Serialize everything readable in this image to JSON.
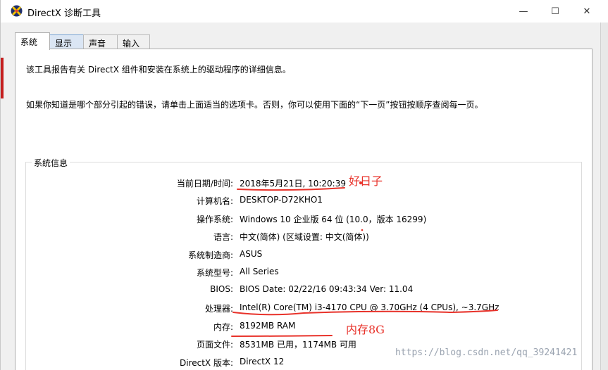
{
  "window": {
    "title": "DirectX 诊断工具",
    "controls": {
      "minimize": "—",
      "maximize": "☐",
      "close": "✕"
    }
  },
  "tabs": [
    {
      "label": "系统",
      "active": true
    },
    {
      "label": "显示",
      "active": false
    },
    {
      "label": "声音",
      "active": false
    },
    {
      "label": "输入",
      "active": false
    }
  ],
  "intro": {
    "line1": "该工具报告有关 DirectX 组件和安装在系统上的驱动程序的详细信息。",
    "line2": "如果你知道是哪个部分引起的错误，请单击上面适当的选项卡。否则，你可以使用下面的“下一页”按钮按顺序查阅每一页。"
  },
  "system_info": {
    "group_title": "系统信息",
    "rows": [
      {
        "label": "当前日期/时间:",
        "value": "2018年5月21日, 10:20:39"
      },
      {
        "label": "计算机名:",
        "value": "DESKTOP-D72KHO1"
      },
      {
        "label": "操作系统:",
        "value": "Windows 10 企业版 64 位 (10.0，版本 16299)"
      },
      {
        "label": "语言:",
        "value": "中文(简体) (区域设置: 中文(简体))"
      },
      {
        "label": "系统制造商:",
        "value": "ASUS"
      },
      {
        "label": "系统型号:",
        "value": "All Series"
      },
      {
        "label": "BIOS:",
        "value": "BIOS Date: 02/22/16 09:43:34 Ver: 11.04"
      },
      {
        "label": "处理器:",
        "value": "Intel(R) Core(TM) i3-4170 CPU @ 3.70GHz (4 CPUs), ~3.7GHz"
      },
      {
        "label": "内存:",
        "value": "8192MB RAM"
      },
      {
        "label": "页面文件:",
        "value": "8531MB 已用，1174MB 可用"
      },
      {
        "label": "DirectX 版本:",
        "value": "DirectX 12"
      }
    ]
  },
  "annotations": {
    "good_day": "好日子",
    "memory": "内存8G",
    "color": "#e8322a"
  },
  "watermark": "https://blog.csdn.net/qq_39241421"
}
